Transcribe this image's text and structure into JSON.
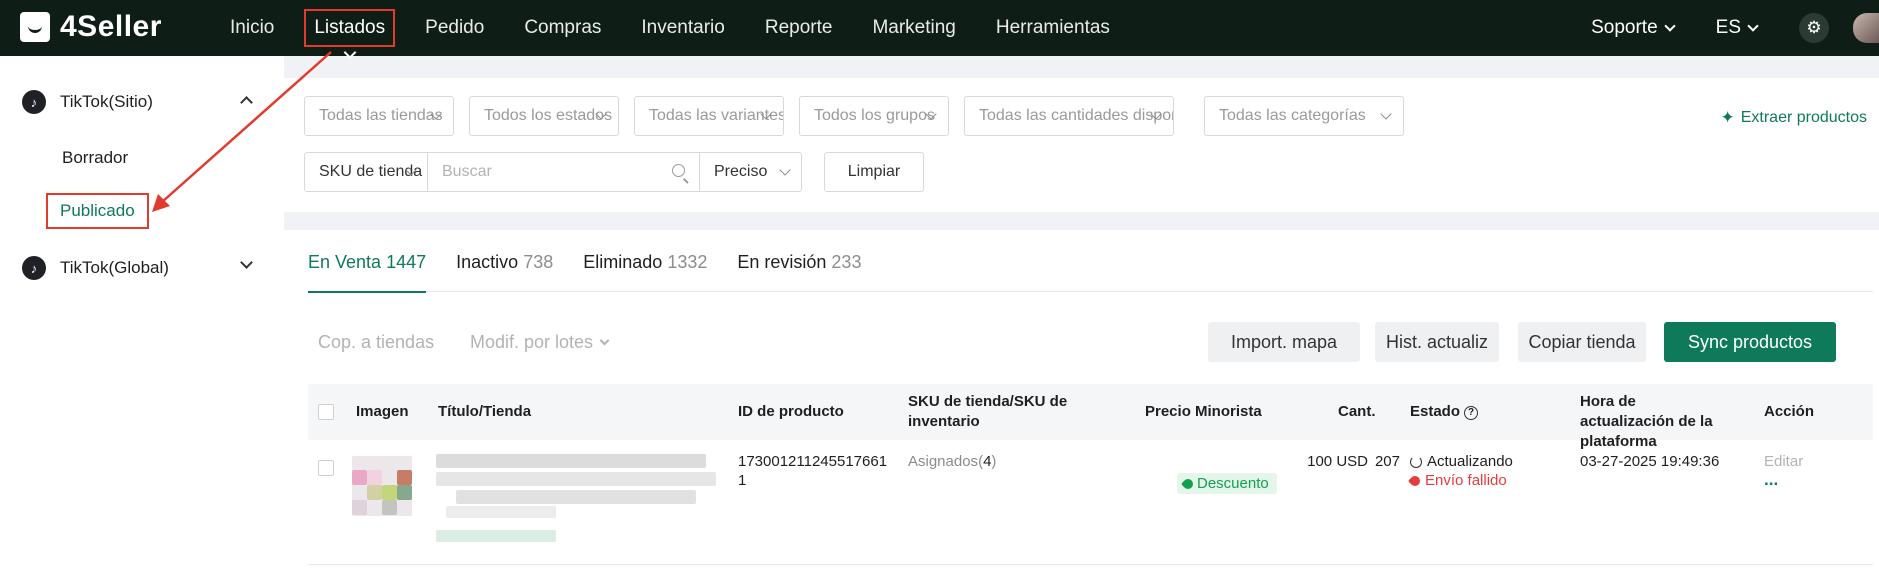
{
  "app": {
    "logo_text": "4Seller",
    "nav": [
      "Inicio",
      "Listados",
      "Pedido",
      "Compras",
      "Inventario",
      "Reporte",
      "Marketing",
      "Herramientas"
    ],
    "active_nav": "Listados",
    "support_label": "Soporte",
    "language_label": "ES"
  },
  "sidebar": {
    "group1": {
      "label": "TikTok(Sitio)",
      "items": [
        "Borrador",
        "Publicado"
      ],
      "active": "Publicado"
    },
    "group2": {
      "label": "TikTok(Global)"
    }
  },
  "filters": {
    "selects": [
      "Todas las tiendas",
      "Todos los estados",
      "Todas las variantes",
      "Todos los grupos",
      "Todas las cantidades disponibles",
      "Todas las categorías"
    ],
    "extract_label": "Extraer productos",
    "sku_select": "SKU de tienda",
    "search_placeholder": "Buscar",
    "match_select": "Preciso",
    "clear_button": "Limpiar"
  },
  "tabs": [
    {
      "label": "En Venta",
      "count": "1447"
    },
    {
      "label": "Inactivo",
      "count": "738"
    },
    {
      "label": "Eliminado",
      "count": "1332"
    },
    {
      "label": "En revisión",
      "count": "233"
    }
  ],
  "toolbar": {
    "copy_to_stores": "Cop. a tiendas",
    "batch_edit": "Modif. por lotes",
    "import_map": "Import. mapa",
    "update_history": "Hist. actualiz",
    "copy_store": "Copiar tienda",
    "sync_products": "Sync productos"
  },
  "table": {
    "headers": {
      "image": "Imagen",
      "title_store": "Título/Tienda",
      "product_id": "ID de producto",
      "sku": "SKU de tienda/SKU de inventario",
      "retail_price": "Precio Minorista",
      "qty": "Cant.",
      "status": "Estado",
      "update_time": "Hora de actualización de la plataforma",
      "action": "Acción"
    },
    "rows": [
      {
        "product_id": "1730012112455176611",
        "assigned_label": "Asignados",
        "assigned_count": "4",
        "price": "100 USD",
        "discount_badge": "Descuento",
        "quantity": "207",
        "status": "Actualizando",
        "status_error": "Envío fallido",
        "updated_at": "03-27-2025 19:49:36",
        "edit_label": "Editar",
        "more_label": "..."
      }
    ]
  },
  "colors": {
    "brand_green": "#0e7a5a",
    "topbar_bg": "#0f1d17",
    "highlight_red": "#e23b2e",
    "error_red": "#e63c3c",
    "discount_green": "#12a150"
  }
}
